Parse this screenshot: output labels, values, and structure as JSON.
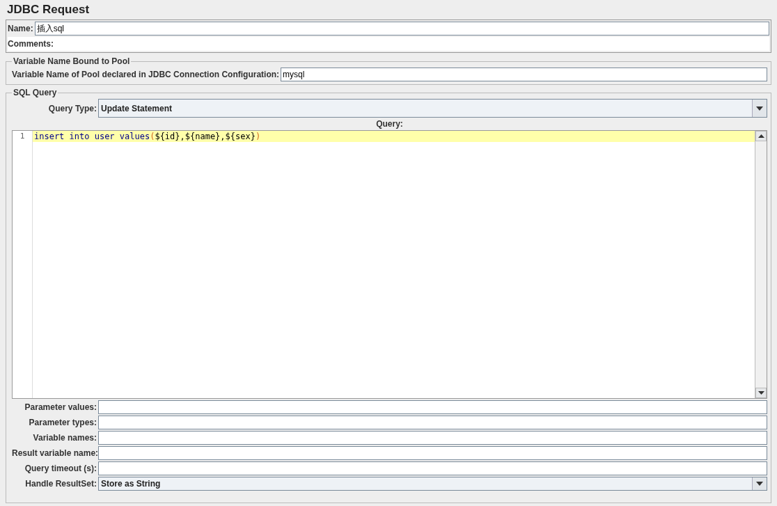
{
  "title": "JDBC Request",
  "name_field": {
    "label": "Name:",
    "value": "插入sql"
  },
  "comments_field": {
    "label": "Comments:"
  },
  "pool_section": {
    "legend": "Variable Name Bound to Pool",
    "label": "Variable Name of Pool declared in JDBC Connection Configuration:",
    "value": "mysql"
  },
  "sql_section": {
    "legend": "SQL Query",
    "query_type": {
      "label": "Query Type:",
      "value": "Update Statement"
    },
    "query_label": "Query:",
    "editor": {
      "lines": [
        {
          "number": "1",
          "current": true,
          "tokens": [
            {
              "text": "insert into user values",
              "kind": "keyword"
            },
            {
              "text": "(",
              "kind": "paren"
            },
            {
              "text": "${id},${name},${sex}",
              "kind": "plain"
            },
            {
              "text": ")",
              "kind": "paren"
            }
          ]
        }
      ]
    },
    "fields": [
      {
        "kind": "text",
        "label": "Parameter values:"
      },
      {
        "kind": "text",
        "label": "Parameter types:"
      },
      {
        "kind": "text",
        "label": "Variable names:"
      },
      {
        "kind": "text",
        "label": "Result variable name:"
      },
      {
        "kind": "text",
        "label": "Query timeout (s):"
      },
      {
        "kind": "dropdown",
        "label": "Handle ResultSet:",
        "value": "Store as String"
      }
    ]
  }
}
